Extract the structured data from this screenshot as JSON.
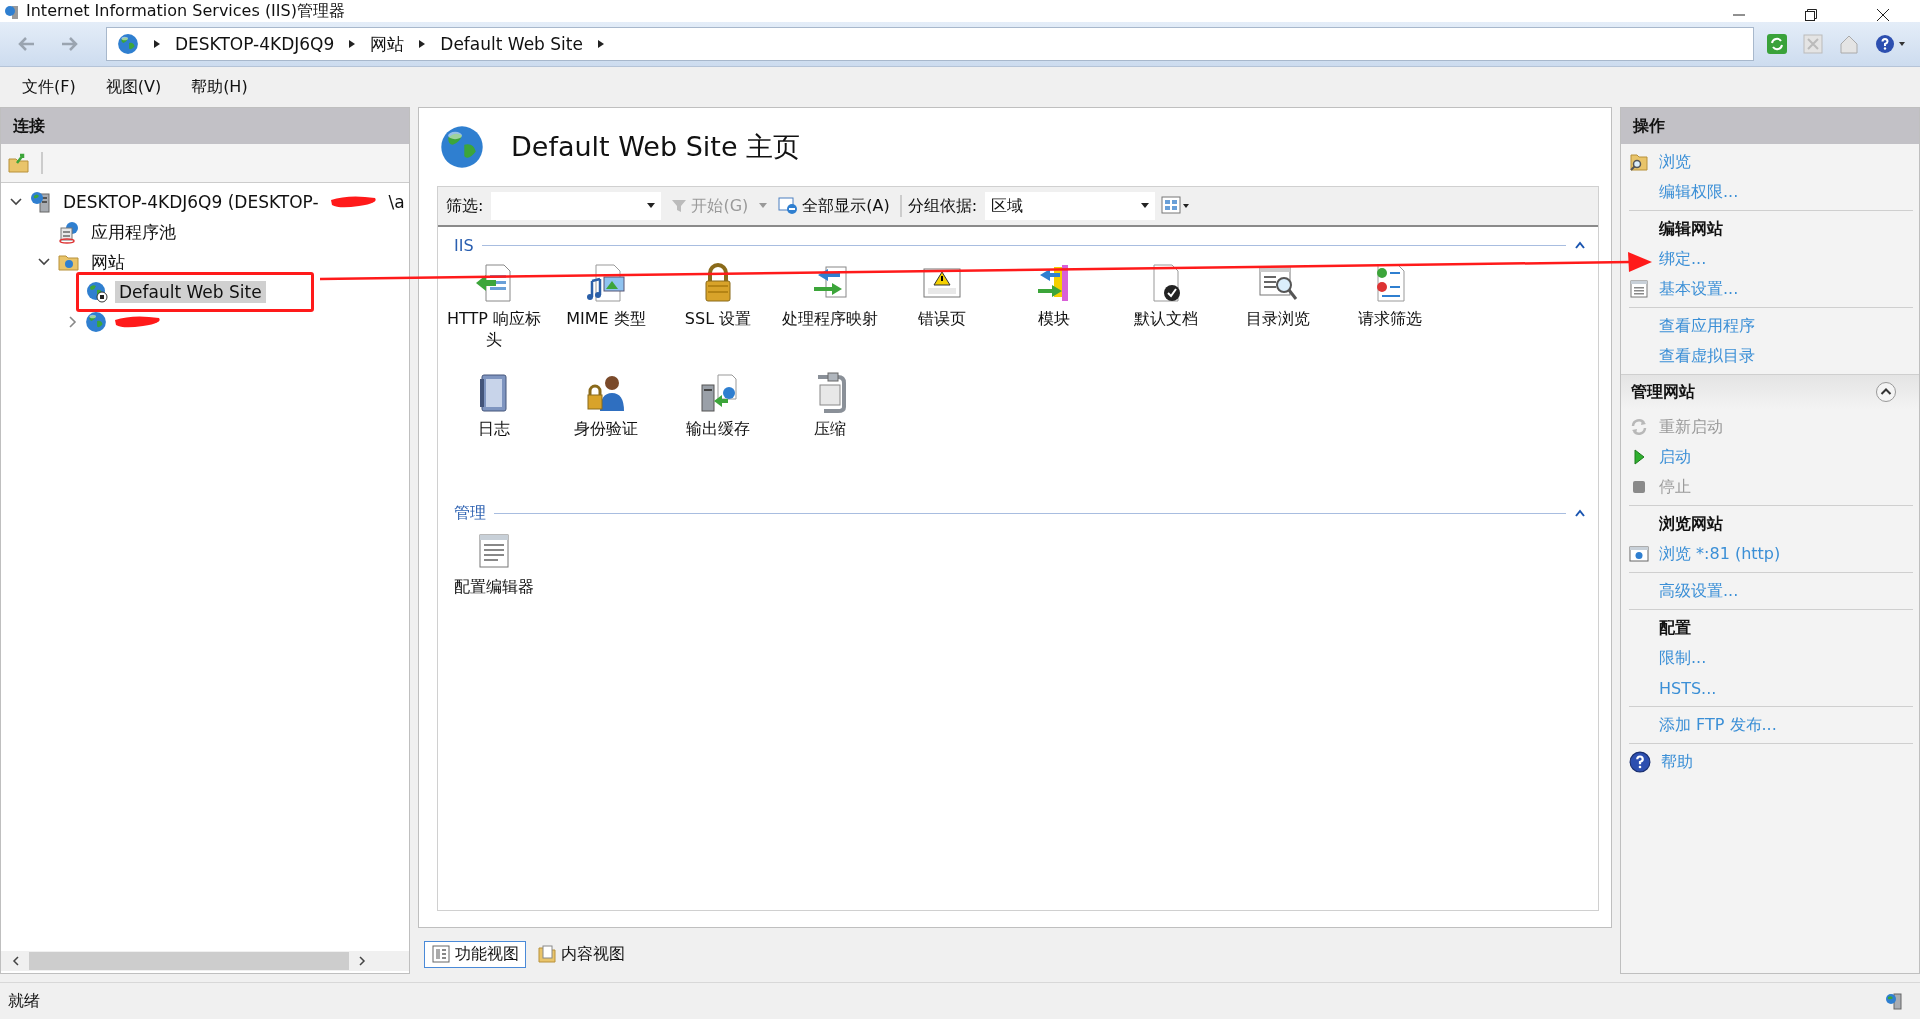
{
  "window": {
    "title": "Internet Information Services (IIS)管理器"
  },
  "breadcrumb": [
    "DESKTOP-4KDJ6Q9",
    "网站",
    "Default Web Site"
  ],
  "menu": [
    "文件(F)",
    "视图(V)",
    "帮助(H)"
  ],
  "connections": {
    "title": "连接",
    "tree": [
      {
        "label": "DESKTOP-4KDJ6Q9 (DESKTOP-",
        "label_end": "\\a",
        "redacted": true,
        "kind": "server",
        "expanded": true,
        "selected": false,
        "children": [
          {
            "label": "应用程序池",
            "kind": "pool",
            "selected": false
          },
          {
            "label": "网站",
            "kind": "folder",
            "expanded": true,
            "selected": false,
            "children": [
              {
                "label": "Default Web Site",
                "kind": "site",
                "selected": true
              },
              {
                "kind": "globe",
                "expanded": false,
                "selected": false,
                "redacted": true
              }
            ]
          }
        ]
      }
    ]
  },
  "home": {
    "title": "Default Web Site 主页",
    "filter": {
      "label": "筛选:",
      "start": "开始(G)",
      "start_disabled": true,
      "show_all": "全部显示(A)",
      "group_label": "分组依据:",
      "group_value": "区域"
    },
    "groups": [
      {
        "title": "IIS",
        "expanded": true,
        "features": [
          {
            "label": "HTTP 响应标头",
            "kind": "headers"
          },
          {
            "label": "MIME 类型",
            "kind": "mime"
          },
          {
            "label": "SSL 设置",
            "kind": "ssl"
          },
          {
            "label": "处理程序映射",
            "kind": "handlers"
          },
          {
            "label": "错误页",
            "kind": "errors"
          },
          {
            "label": "模块",
            "kind": "modules"
          },
          {
            "label": "默认文档",
            "kind": "document"
          },
          {
            "label": "目录浏览",
            "kind": "browse"
          },
          {
            "label": "请求筛选",
            "kind": "filtering"
          },
          {
            "label": "日志",
            "kind": "log"
          },
          {
            "label": "身份验证",
            "kind": "auth"
          },
          {
            "label": "输出缓存",
            "kind": "cache"
          },
          {
            "label": "压缩",
            "kind": "compress"
          }
        ]
      },
      {
        "title": "管理",
        "expanded": true,
        "features": [
          {
            "label": "配置编辑器",
            "kind": "editor"
          }
        ]
      }
    ],
    "views": [
      {
        "label": "功能视图",
        "kind": "features",
        "selected": true
      },
      {
        "label": "内容视图",
        "kind": "content",
        "selected": false
      }
    ]
  },
  "actions": {
    "title": "操作",
    "sections": [
      {
        "items": [
          {
            "label": "浏览",
            "kind": "folder",
            "disabled": false
          },
          {
            "label": "编辑权限...",
            "kind": "text",
            "disabled": false
          }
        ]
      },
      {
        "title": "编辑网站",
        "items": [
          {
            "label": "绑定...",
            "kind": "text",
            "disabled": false
          },
          {
            "label": "基本设置...",
            "kind": "form",
            "disabled": false
          }
        ]
      },
      {
        "items": [
          {
            "label": "查看应用程序",
            "kind": "text",
            "disabled": false
          },
          {
            "label": "查看虚拟目录",
            "kind": "text",
            "disabled": false
          }
        ]
      },
      {
        "group": "管理网站",
        "expanded": true,
        "items": [
          {
            "label": "重新启动",
            "kind": "refresh",
            "disabled": true
          },
          {
            "label": "启动",
            "kind": "play",
            "disabled": false
          },
          {
            "label": "停止",
            "kind": "stop",
            "disabled": true
          }
        ]
      },
      {
        "title": "浏览网站",
        "items": [
          {
            "label": "浏览 *:81 (http)",
            "kind": "window",
            "disabled": false
          }
        ]
      },
      {
        "items": [
          {
            "label": "高级设置...",
            "kind": "text",
            "disabled": false
          }
        ]
      },
      {
        "title": "配置",
        "items": [
          {
            "label": "限制...",
            "kind": "text",
            "disabled": false
          },
          {
            "label": "HSTS...",
            "kind": "text",
            "disabled": false
          }
        ]
      },
      {
        "items": [
          {
            "label": "添加 FTP 发布...",
            "kind": "text",
            "disabled": false
          }
        ]
      },
      {
        "items": [
          {
            "label": "帮助",
            "kind": "help",
            "disabled": false
          }
        ]
      }
    ]
  },
  "status_bar": {
    "text": "就绪"
  }
}
